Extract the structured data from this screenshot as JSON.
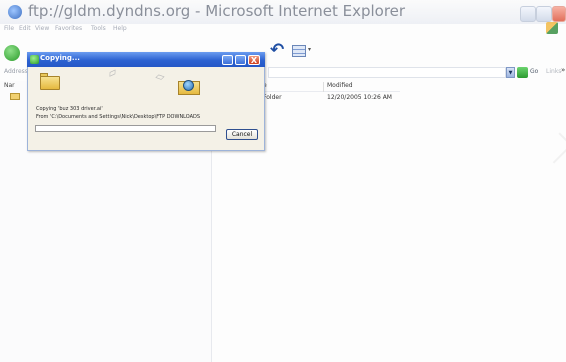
{
  "window": {
    "title": "ftp://gldm.dyndns.org - Microsoft Internet Explorer"
  },
  "menu": [
    "File",
    "Edit",
    "View",
    "Favorites",
    "Tools",
    "Help"
  ],
  "address": {
    "label": "Address",
    "go_label": "Go",
    "links_label": "Links",
    "more": "»"
  },
  "list": {
    "name_header": "Nar",
    "type_header_tail": "e",
    "modified_header": "Modified",
    "rows": [
      {
        "type_tail": "Folder",
        "modified": "12/20/2005 10:26 AM"
      }
    ]
  },
  "dialog": {
    "title": "Copying...",
    "copying_line": "Copying 'buz 303 driver.ai'",
    "from_line": "From 'C:\\Documents and Settings\\Nick\\Desktop\\FTP DOWNLOADS",
    "cancel_label": "Cancel",
    "progress": 0.0,
    "close_glyph": "X"
  },
  "colors": {
    "dialog_title": "#2c62d1",
    "progress": "#3ab53a"
  }
}
